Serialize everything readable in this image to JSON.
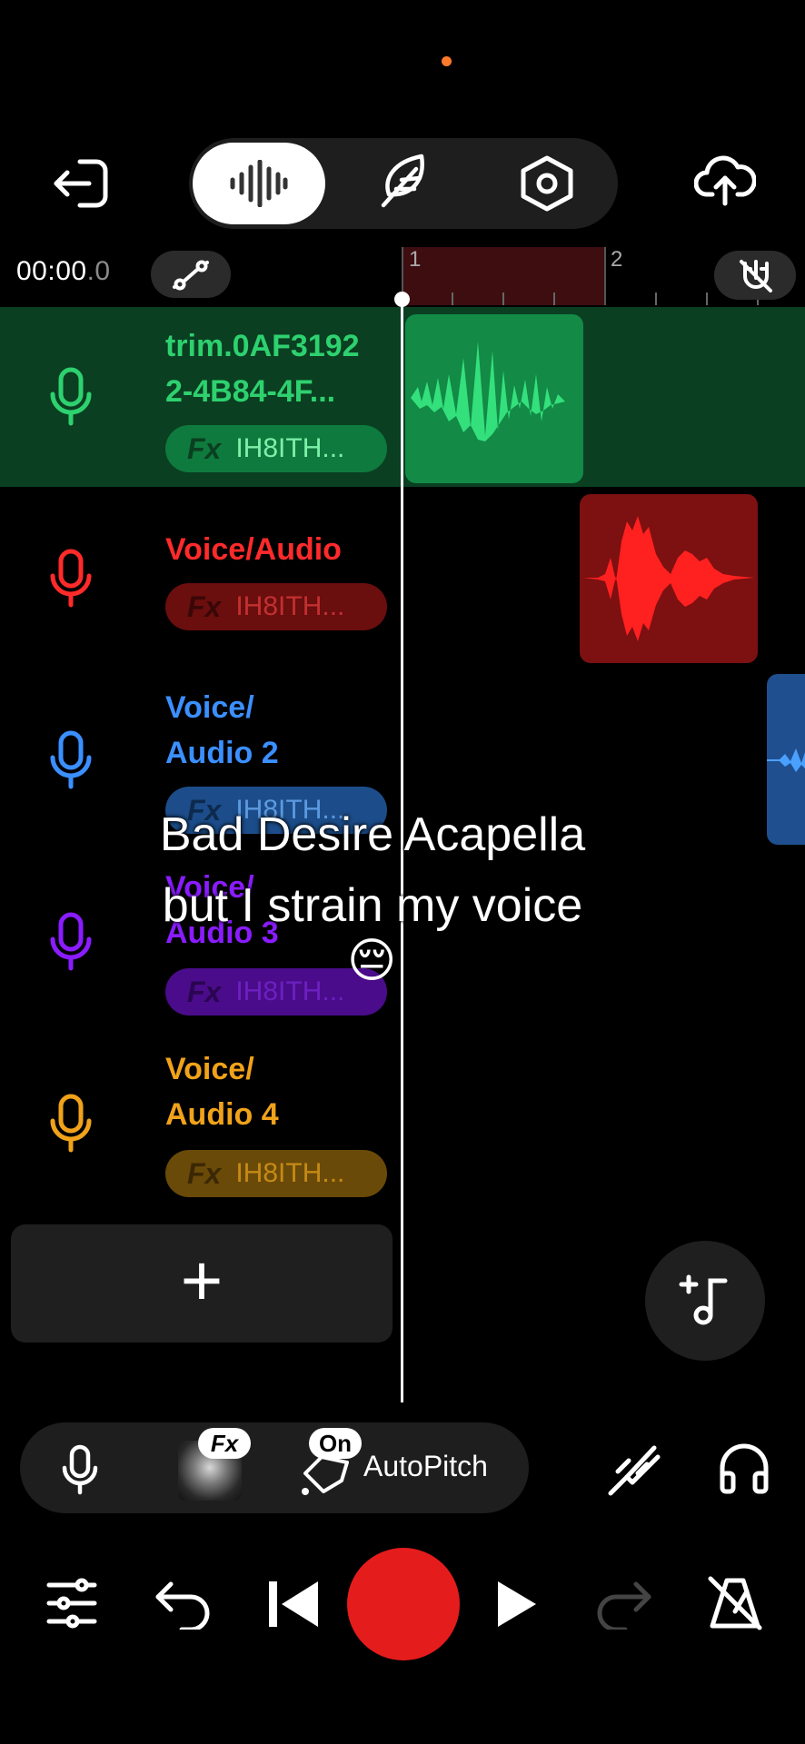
{
  "toolbar": {
    "back_icon": "exit-arrow-icon",
    "modes": [
      "waveform-icon",
      "feather-icon",
      "settings-hex-icon"
    ],
    "upload_icon": "cloud-upload-icon"
  },
  "timeline": {
    "time_main": "00:00",
    "time_fraction": ".0",
    "bar_1": "1",
    "bar_2": "2"
  },
  "tracks": [
    {
      "name": "trim.0AF3192 2-4B84-4F...",
      "fx": "Fx",
      "preset": "IH8ITH...",
      "color": "#2ed16f",
      "chip_bg": "#0f7a3d",
      "chip_text": "#7ef0a9"
    },
    {
      "name": "Voice/Audio",
      "fx": "Fx",
      "preset": "IH8ITH...",
      "color": "#ff2a2a",
      "chip_bg": "#6a0e0e",
      "chip_text": "#c23030"
    },
    {
      "name": "Voice/ Audio 2",
      "fx": "Fx",
      "preset": "IH8ITH...",
      "color": "#3b8fff",
      "chip_bg": "#1c4d8a",
      "chip_text": "#5c9ae0"
    },
    {
      "name": "Voice/ Audio 3",
      "fx": "Fx",
      "preset": "IH8ITH...",
      "color": "#8a1cff",
      "chip_bg": "#4a0c8a",
      "chip_text": "#6c20c0"
    },
    {
      "name": "Voice/ Audio 4",
      "fx": "Fx",
      "preset": "IH8ITH...",
      "color": "#f0a21a",
      "chip_bg": "#6a4a08",
      "chip_text": "#c58a16"
    }
  ],
  "add_track_label": "+",
  "caption": {
    "line1": "Bad Desire Acapella",
    "line2": "but I strain my voice",
    "emoji": "😔"
  },
  "tools": {
    "fx_badge": "Fx",
    "on_badge": "On",
    "autopitch": "AutoPitch"
  },
  "colors": {
    "record": "#e51c1c",
    "background": "#000000"
  }
}
